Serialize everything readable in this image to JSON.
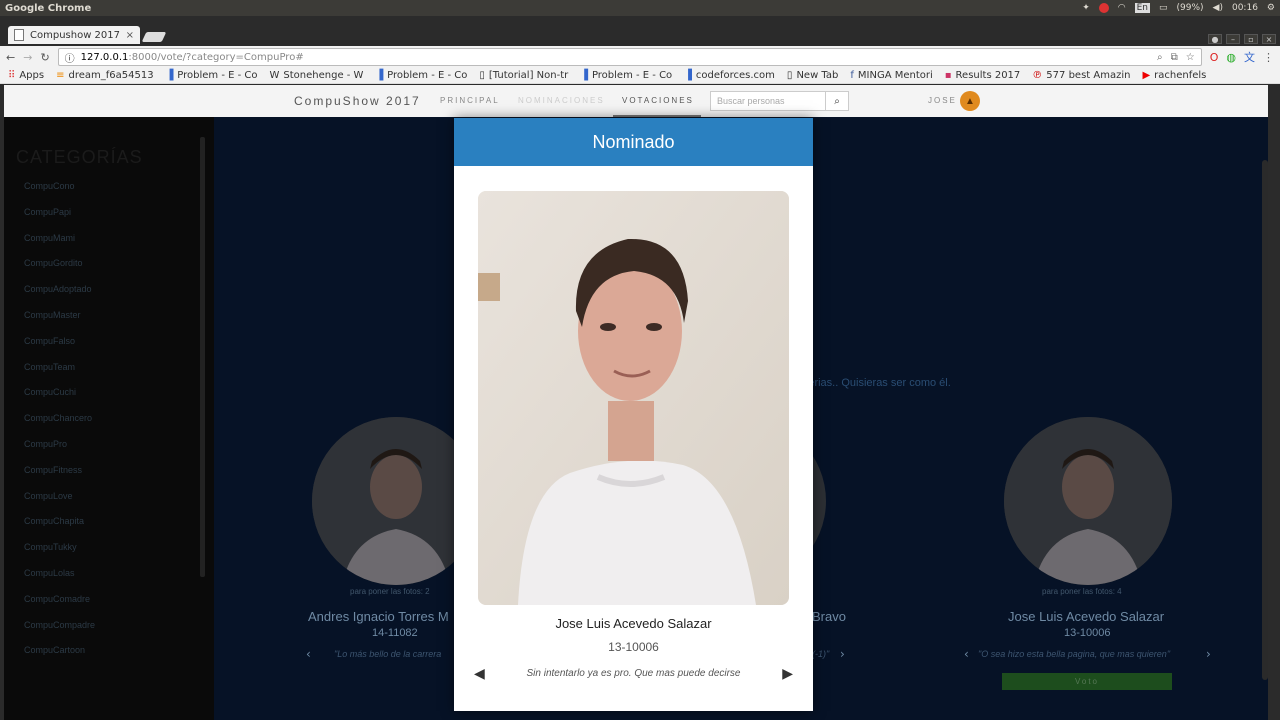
{
  "os": {
    "app_title": "Google Chrome",
    "battery": "(99%)",
    "time": "00:16",
    "lang": "En"
  },
  "browser": {
    "tab_title": "Compushow 2017",
    "tab_close": "×",
    "url_host": "127.0.0.1",
    "url_path": ":8000/vote/?category=CompuPro#",
    "bookmarks": [
      "Apps",
      "dream_f6a54513",
      "Problem - E - Co",
      "Stonehenge - W",
      "Problem - E - Co",
      "[Tutorial] Non-tr",
      "Problem - E - Co",
      "codeforces.com",
      "New Tab",
      "MINGA Mentori",
      "Results 2017",
      "577 best Amazin",
      "rachenfels"
    ]
  },
  "site": {
    "brand": "CompuShow 2017",
    "nav": {
      "principal": "PRINCIPAL",
      "nominaciones": "NOMINACIONES",
      "votaciones": "VOTACIONES"
    },
    "search_placeholder": "Buscar personas",
    "user": "JOSE"
  },
  "sidebar": {
    "title": "CATEGORÍAS",
    "items": [
      "CompuCono",
      "CompuPapi",
      "CompuMami",
      "CompuGordito",
      "CompuAdoptado",
      "CompuMaster",
      "CompuFalso",
      "CompuTeam",
      "CompuCuchi",
      "CompuChancero",
      "CompuPro",
      "CompuFitness",
      "CompuLove",
      "CompuChapita",
      "CompuTukky",
      "CompuLolas",
      "CompuComadre",
      "CompuCompadre",
      "CompuCartoon"
    ]
  },
  "background": {
    "description_fragment": "materias.. Quisieras ser como él.",
    "left_card": {
      "caption": "para poner las fotos: 2",
      "name": "Andres Ignacio Torres M",
      "id": "14-11082",
      "quote": "\"Lo más bello de la carrera"
    },
    "middle_card": {
      "name": "Bravo",
      "quote": "(-1)\""
    },
    "right_card": {
      "caption": "para poner las fotos: 4",
      "name": "Jose Luis Acevedo Salazar",
      "id": "13-10006",
      "quote": "\"O sea hizo esta bella pagina, que mas quieren\"",
      "vote_label": "Voto"
    }
  },
  "modal": {
    "title": "Nominado",
    "name": "Jose Luis Acevedo Salazar",
    "id": "13-10006",
    "quote": "Sin intentarlo ya es pro. Que mas puede decirse"
  },
  "colors": {
    "modal_header": "#2a80c0",
    "vote_button": "#1d4d1d",
    "page_bg": "#061226"
  }
}
